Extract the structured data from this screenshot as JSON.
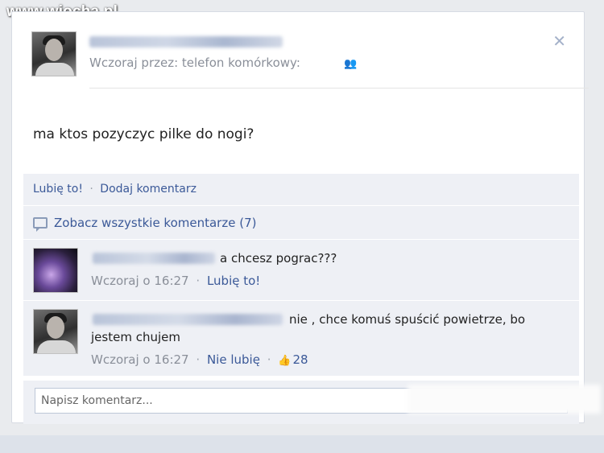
{
  "watermark": "www.wiocha.pl",
  "post": {
    "meta": "Wczoraj przez: telefon komórkowy:",
    "status": "ma ktos pozyczyc pilke do nogi?"
  },
  "actions": {
    "like": "Lubię to!",
    "separator": "·",
    "comment": "Dodaj komentarz"
  },
  "view_all": "Zobacz wszystkie komentarze (7)",
  "comments": [
    {
      "text": "a chcesz pograc???",
      "time": "Wczoraj o 16:27",
      "separator": "·",
      "like": "Lubię to!"
    },
    {
      "text": "nie , chce komuś spuścić powietrze, bo jestem chujem",
      "time": "Wczoraj o 16:27",
      "separator": "·",
      "unlike": "Nie lubię",
      "separator2": "·",
      "like_count": "28"
    }
  ],
  "write_comment": {
    "placeholder": "Napisz komentarz..."
  },
  "icons": {
    "close": "close-icon",
    "audience": "people-icon",
    "comment": "comment-bubble-icon",
    "like": "thumbs-up-icon"
  },
  "colors": {
    "link": "#3b5998",
    "meta": "#8a8f99",
    "feedback_bg": "#eef0f5"
  }
}
